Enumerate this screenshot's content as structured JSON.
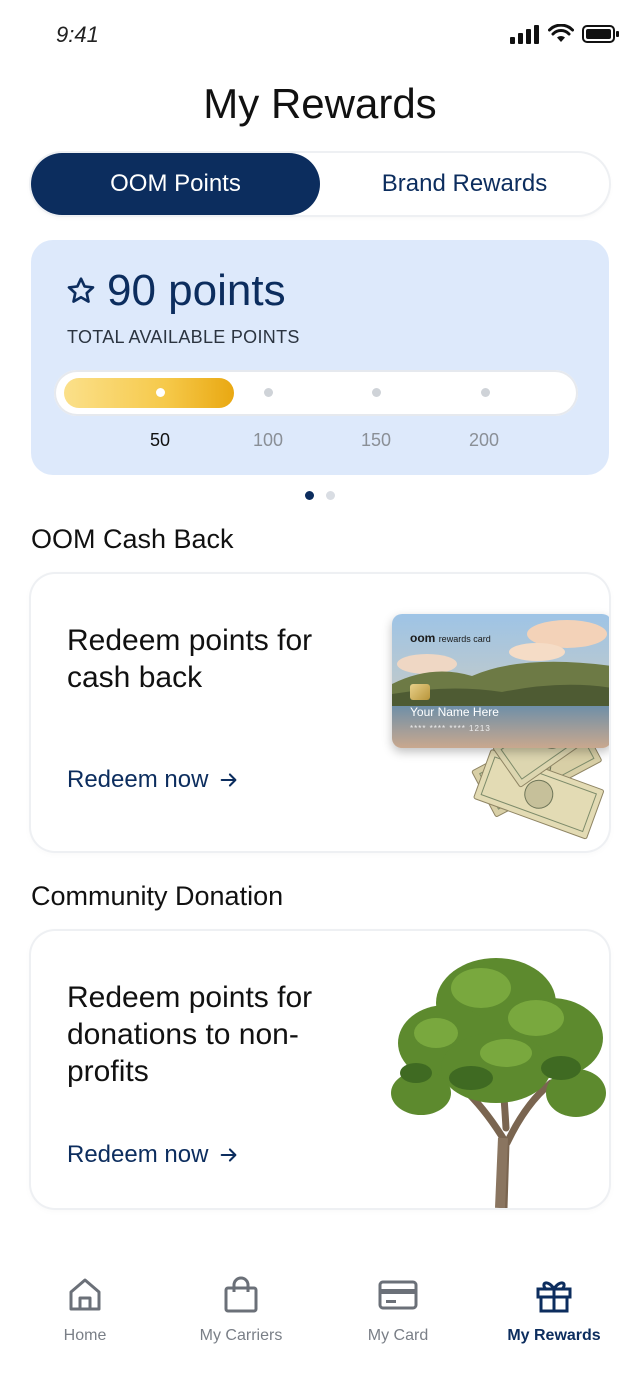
{
  "status_bar": {
    "time": "9:41"
  },
  "page": {
    "title": "My Rewards"
  },
  "segments": {
    "active": "OOM Points",
    "inactive": "Brand Rewards"
  },
  "points": {
    "value": "90 points",
    "label": "TOTAL AVAILABLE POINTS",
    "current": 90,
    "ticks": [
      "50",
      "100",
      "150",
      "200"
    ]
  },
  "sections": [
    {
      "title": "OOM Cash Back",
      "card_title": "Redeem points for cash back",
      "link": "Redeem now"
    },
    {
      "title": "Community Donation",
      "card_title": "Redeem points for donations to non-profits",
      "link": "Redeem now"
    }
  ],
  "credit_card": {
    "brand": "oom",
    "brand_suffix": "rewards card",
    "name": "Your Name Here",
    "number": "**** **** **** 1213"
  },
  "tabbar": {
    "items": [
      {
        "label": "Home",
        "icon": "home-icon"
      },
      {
        "label": "My Carriers",
        "icon": "shopping-bag-icon"
      },
      {
        "label": "My Card",
        "icon": "credit-card-icon"
      },
      {
        "label": "My Rewards",
        "icon": "gift-icon"
      }
    ],
    "active_index": 3
  },
  "colors": {
    "primary": "#0c2d5e",
    "card_bg": "#dde9fb",
    "progress_gold": "#f6c94a"
  }
}
